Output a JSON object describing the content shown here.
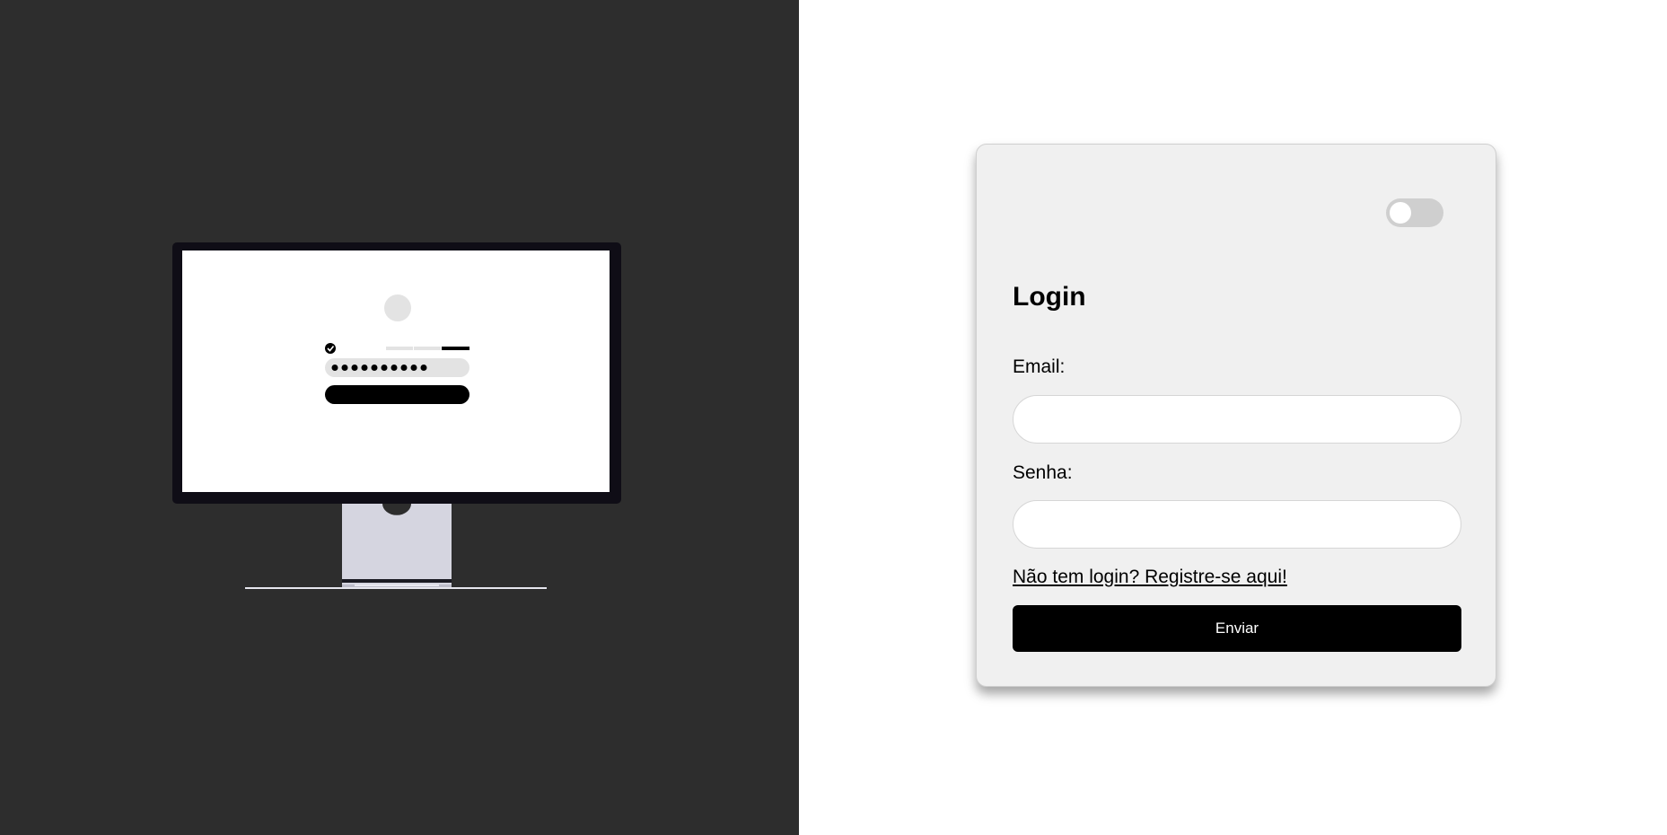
{
  "colors": {
    "left_background": "#2d2d2d",
    "right_background": "#ffffff",
    "card_background": "#f0f0f0",
    "button_background": "#000000",
    "button_text": "#ffffff",
    "toggle_track": "#cfcfcf",
    "monitor_bezel": "#0f0d16",
    "monitor_stand": "#d5d5e0"
  },
  "illustration": {
    "password_mask": "●●●●●●●●●",
    "icons": [
      "user-avatar-icon",
      "checkmark-icon",
      "password-strength-meter"
    ]
  },
  "theme_toggle": {
    "state": "off"
  },
  "login_form": {
    "title": "Login",
    "email_label": "Email:",
    "email_value": "",
    "password_label": "Senha:",
    "password_value": "",
    "register_link": "Não tem login? Registre-se aqui!",
    "submit_label": "Enviar"
  }
}
